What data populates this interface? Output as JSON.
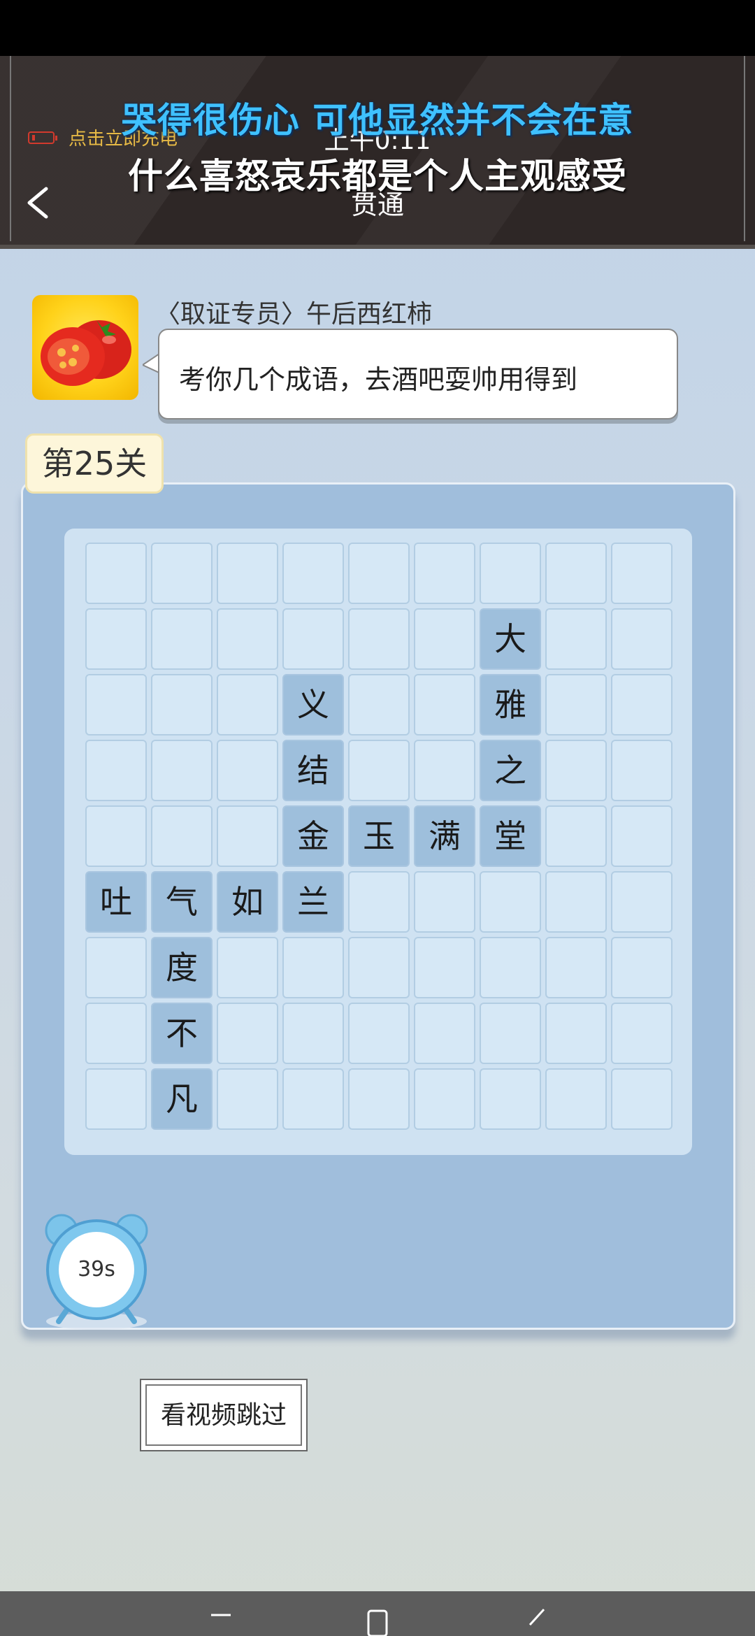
{
  "header": {
    "lyric_line1": "哭得很伤心 可他显然并不会在意",
    "lyric_line2": "什么喜怒哀乐都是个人主观感受",
    "charge_text": "点击立即充电",
    "time": "上午0:11",
    "level_title": "贯通",
    "back_icon": "chevron-left-icon"
  },
  "dialog": {
    "speaker": "〈取证专员〉午后西红柿",
    "message": "考你几个成语，去酒吧耍帅用得到",
    "avatar_icon": "tomato-avatar"
  },
  "level": {
    "label": "第25关"
  },
  "grid": {
    "rows": 9,
    "cols": 9,
    "cells": [
      {
        "row": 2,
        "col": 7,
        "char": "大"
      },
      {
        "row": 3,
        "col": 4,
        "char": "义"
      },
      {
        "row": 3,
        "col": 7,
        "char": "雅"
      },
      {
        "row": 4,
        "col": 4,
        "char": "结"
      },
      {
        "row": 4,
        "col": 7,
        "char": "之"
      },
      {
        "row": 5,
        "col": 4,
        "char": "金"
      },
      {
        "row": 5,
        "col": 5,
        "char": "玉"
      },
      {
        "row": 5,
        "col": 6,
        "char": "满"
      },
      {
        "row": 5,
        "col": 7,
        "char": "堂"
      },
      {
        "row": 6,
        "col": 1,
        "char": "吐"
      },
      {
        "row": 6,
        "col": 2,
        "char": "气"
      },
      {
        "row": 6,
        "col": 3,
        "char": "如"
      },
      {
        "row": 6,
        "col": 4,
        "char": "兰"
      },
      {
        "row": 7,
        "col": 2,
        "char": "度"
      },
      {
        "row": 8,
        "col": 2,
        "char": "不"
      },
      {
        "row": 9,
        "col": 2,
        "char": "凡"
      }
    ]
  },
  "timer": {
    "text": "39s",
    "icon": "alarm-clock-icon"
  },
  "skip_button": {
    "label": "看视频跳过"
  },
  "colors": {
    "header_bg": "#2e2726",
    "lyric_blue": "#3fc1ff",
    "board_bg": "#a0bedc",
    "cell_empty": "#d6e8f6",
    "cell_filled": "#9ebfdc"
  }
}
